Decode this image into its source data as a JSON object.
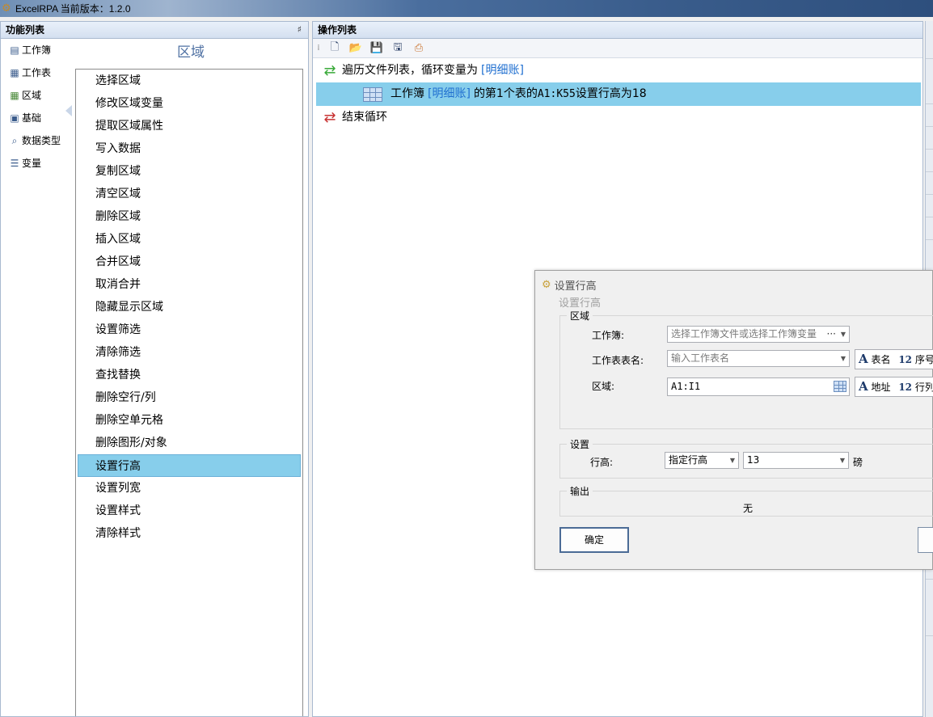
{
  "window": {
    "title": "ExcelRPA 当前版本：1.2.0"
  },
  "left_panel": {
    "header": "功能列表",
    "pin": "♯",
    "categories": [
      {
        "label": "工作簿",
        "icon": "document-icon"
      },
      {
        "label": "工作表",
        "icon": "table-icon"
      },
      {
        "label": "区域",
        "icon": "range-icon"
      },
      {
        "label": "基础",
        "icon": "book-icon"
      },
      {
        "label": "数据类型",
        "icon": "search-icon"
      },
      {
        "label": "变量",
        "icon": "list-icon"
      }
    ],
    "section_title": "区域",
    "functions": [
      "选择区域",
      "修改区域变量",
      "提取区域属性",
      "写入数据",
      "复制区域",
      "清空区域",
      "删除区域",
      "插入区域",
      "合并区域",
      "取消合并",
      "隐藏显示区域",
      "设置筛选",
      "清除筛选",
      "查找替换",
      "删除空行/列",
      "删除空单元格",
      "删除图形/对象",
      "设置行高",
      "设置列宽",
      "设置样式",
      "清除样式"
    ],
    "selected_function": "设置行高"
  },
  "ops_panel": {
    "header": "操作列表",
    "rows": [
      {
        "prefix": "遍历文件列表，循环变量为",
        "var": "[明细账]",
        "suffix": ""
      },
      {
        "prefix": "工作簿",
        "var": "[明细账]",
        "suffix": "的第1个表的",
        "code": "A1:K55",
        "tail": "设置行高为18"
      },
      {
        "prefix": "结束循环"
      }
    ]
  },
  "dialog": {
    "title": "设置行高",
    "subtitle": "设置行高",
    "group_range": "区域",
    "workbook_label": "工作簿:",
    "workbook_placeholder": "选择工作簿文件或选择工作簿变量",
    "workbook_more": "···",
    "sheet_label": "工作表表名:",
    "sheet_placeholder": "输入工作表名",
    "sheet_tag_name": "表名",
    "sheet_tag_index": "序号",
    "range_label": "区域:",
    "range_value": "A1:I1",
    "range_tag_addr": "地址",
    "range_tag_rc": "行列",
    "num12": "12",
    "group_settings": "设置",
    "row_height_label": "行高:",
    "row_height_mode": "指定行高",
    "row_height_value": "13",
    "unit": "磅",
    "group_output": "输出",
    "output_value": "无",
    "ok_label": "确定"
  }
}
